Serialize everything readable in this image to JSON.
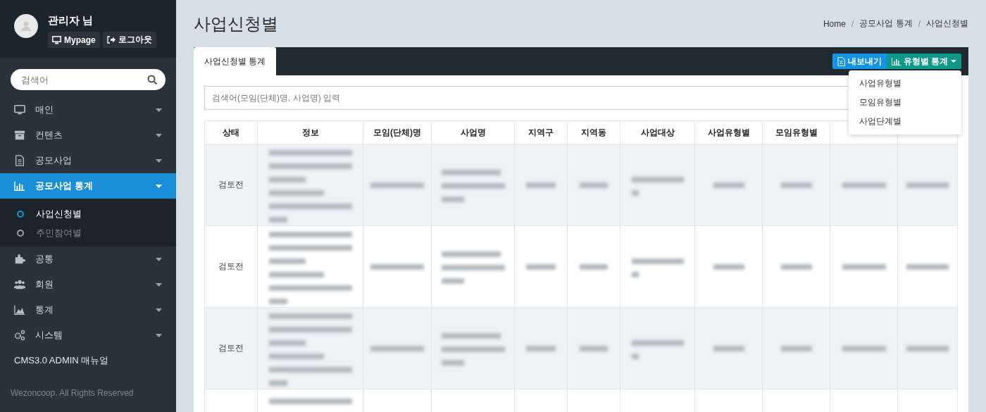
{
  "sidebar": {
    "user": {
      "name": "관리자 님",
      "mypage_button": "Mypage",
      "logout_button": "로그아웃"
    },
    "search": {
      "placeholder": "검색어"
    },
    "menu": [
      {
        "kind": "monitor",
        "label": "매인",
        "selected": false
      },
      {
        "kind": "archive",
        "label": "컨텐츠",
        "selected": false
      },
      {
        "kind": "document",
        "label": "공모사업",
        "selected": false
      },
      {
        "kind": "bar-chart",
        "label": "공모사업 통계",
        "selected": true,
        "expanded": true,
        "children": [
          {
            "label": "사업신청별",
            "selected": true
          },
          {
            "label": "주민참여별",
            "selected": false
          }
        ]
      },
      {
        "kind": "puzzle",
        "label": "공통",
        "selected": false
      },
      {
        "kind": "users",
        "label": "회원",
        "selected": false
      },
      {
        "kind": "area-chart",
        "label": "통계",
        "selected": false
      },
      {
        "kind": "gears",
        "label": "시스템",
        "selected": false
      },
      {
        "kind": "link",
        "label": "CMS3.0 ADMIN 매뉴얼",
        "selected": false
      }
    ],
    "footer": "Wezoncoop. All Rights Reserved"
  },
  "page": {
    "title": "사업신청별",
    "breadcrumb": [
      "Home",
      "공모사업 통계",
      "사업신청별"
    ],
    "breadcrumb_separator": "/"
  },
  "card": {
    "tabs": [
      {
        "label": "사업신청별 통계",
        "selected": true
      }
    ],
    "export_button": "내보내기",
    "stats_button": "유형별 통계",
    "stats_menu": {
      "expanded": true,
      "items": [
        "사업유형별",
        "모임유형별",
        "사업단계별"
      ]
    },
    "search": {
      "placeholder": "검색어(모임(단체)명, 사업명) 입력"
    },
    "table": {
      "columns": [
        "상태",
        "정보",
        "모임(단체)명",
        "사업명",
        "지역구",
        "지역동",
        "사업대상",
        "사업유형별",
        "모임유형별"
      ],
      "rows": [
        {
          "status": "검토전"
        },
        {
          "status": "검토전"
        },
        {
          "status": "검토전"
        },
        {
          "status": null
        }
      ]
    }
  }
}
